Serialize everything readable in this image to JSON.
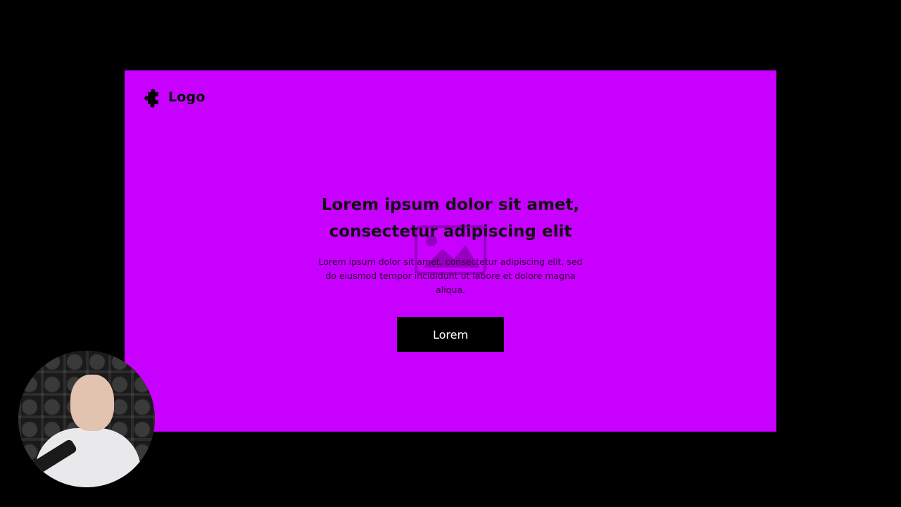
{
  "hero": {
    "background_color": "#c800ff",
    "logo": {
      "icon": "puzzle-piece-icon",
      "text": "Logo"
    },
    "headline": "Lorem ipsum dolor sit amet, consectetur adipiscing elit",
    "subtext": "Lorem ipsum dolor sit amet, consectetur adipiscing elit, sed do eiusmod tempor incididunt ut labore et dolore magna aliqua.",
    "cta_label": "Lorem",
    "watermark_icon": "image-placeholder-icon"
  },
  "webcam": {
    "icon": "presenter-webcam"
  }
}
